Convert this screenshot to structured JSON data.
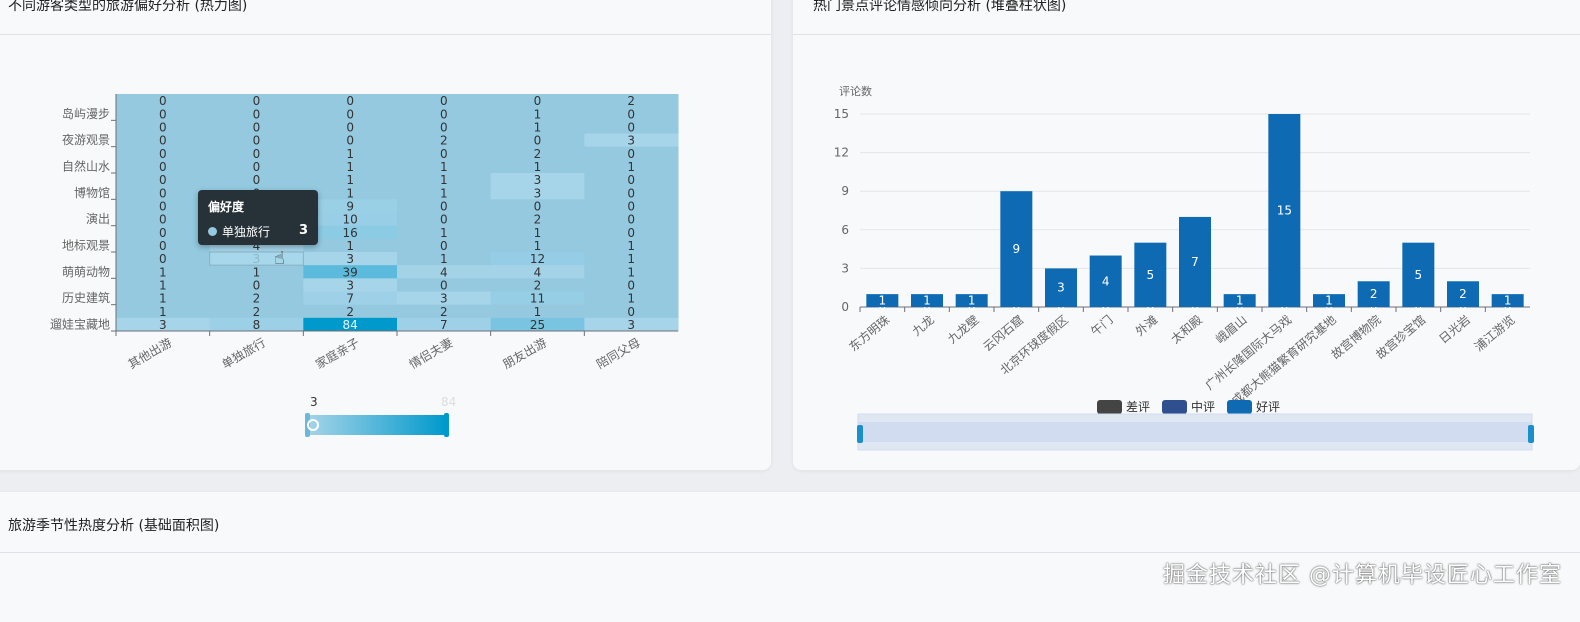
{
  "heatmap_card": {
    "title": "不同游客类型的旅游偏好分析 (热力图)"
  },
  "bar_card": {
    "title": "热门景点评论情感倾向分析 (堆叠柱状图)"
  },
  "area_card": {
    "title": "旅游季节性热度分析 (基础面积图)"
  },
  "tooltip": {
    "title": "偏好度",
    "series": "单独旅行",
    "value": "3"
  },
  "visual_map": {
    "min": "3",
    "max": "84",
    "low_color": "#a6d4e8",
    "high_color": "#0099cc"
  },
  "watermark": "掘金技术社区 @计算机毕设匠心工作室",
  "chart_data": [
    {
      "type": "heatmap",
      "title": "不同游客类型的旅游偏好分析 (热力图)",
      "x": [
        "其他出游",
        "单独旅行",
        "家庭亲子",
        "情侣夫妻",
        "朋友出游",
        "陪同父母"
      ],
      "y_labels_shown": [
        "岛屿漫步",
        "夜游观景",
        "自然山水",
        "博物馆",
        "演出",
        "地标观景",
        "萌萌动物",
        "历史建筑",
        "遛娃宝藏地"
      ],
      "values": [
        [
          0,
          0,
          0,
          0,
          0,
          2
        ],
        [
          0,
          0,
          0,
          0,
          1,
          0
        ],
        [
          0,
          0,
          0,
          0,
          1,
          0
        ],
        [
          0,
          0,
          0,
          2,
          0,
          3
        ],
        [
          0,
          0,
          1,
          0,
          2,
          0
        ],
        [
          0,
          0,
          1,
          1,
          1,
          1
        ],
        [
          0,
          0,
          1,
          1,
          3,
          0
        ],
        [
          0,
          0,
          1,
          1,
          3,
          0
        ],
        [
          0,
          0,
          9,
          0,
          0,
          0
        ],
        [
          0,
          0,
          10,
          0,
          2,
          0
        ],
        [
          0,
          0,
          16,
          1,
          1,
          0
        ],
        [
          0,
          4,
          1,
          0,
          1,
          1
        ],
        [
          0,
          3,
          3,
          1,
          12,
          1
        ],
        [
          1,
          1,
          39,
          4,
          4,
          1
        ],
        [
          1,
          0,
          3,
          0,
          2,
          0
        ],
        [
          1,
          2,
          7,
          3,
          11,
          1
        ],
        [
          1,
          2,
          2,
          2,
          1,
          0
        ],
        [
          3,
          8,
          84,
          7,
          25,
          3
        ]
      ],
      "range": [
        3,
        84
      ]
    },
    {
      "type": "bar",
      "stacked": true,
      "title": "热门景点评论情感倾向分析 (堆叠柱状图)",
      "ylabel": "评论数",
      "ylim": [
        0,
        15
      ],
      "yticks": [
        0,
        3,
        6,
        9,
        12,
        15
      ],
      "categories": [
        "东方明珠",
        "九龙",
        "九龙壁",
        "云冈石窟",
        "北京环球度假区",
        "午门",
        "外滩",
        "太和殿",
        "峨眉山",
        "广州长隆国际大马戏",
        "成都大熊猫繁育研究基地",
        "故宫博物院",
        "故宫珍宝馆",
        "日光岩",
        "浦江游览"
      ],
      "series": [
        {
          "name": "差评",
          "color": "#444444",
          "values": [
            0,
            0,
            0,
            0,
            0,
            0,
            0,
            0,
            0,
            0,
            0,
            0,
            0,
            0,
            0
          ]
        },
        {
          "name": "中评",
          "color": "#2f4f8f",
          "values": [
            0,
            0,
            0,
            0,
            0,
            0,
            0,
            0,
            0,
            0,
            0,
            0,
            0,
            0,
            0
          ]
        },
        {
          "name": "好评",
          "color": "#0e6bb3",
          "values": [
            1,
            1,
            1,
            9,
            3,
            4,
            5,
            7,
            1,
            15,
            1,
            2,
            5,
            2,
            1
          ]
        }
      ],
      "legend": "bottom"
    }
  ]
}
